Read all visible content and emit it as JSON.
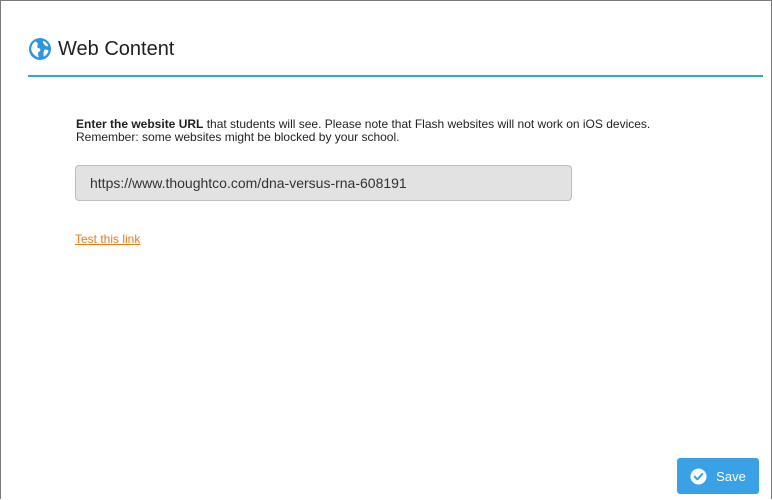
{
  "header": {
    "title": "Web Content",
    "icon": "globe-icon",
    "accent": "#35a0e6"
  },
  "description": {
    "bold": "Enter the website URL",
    "line1_rest": " that students will see. Please note that Flash websites will not work on iOS devices.",
    "line2": "Remember: some websites might be blocked by your school."
  },
  "url_input": {
    "value": "https://www.thoughtco.com/dna-versus-rna-608191"
  },
  "test_link": {
    "label": "Test this link",
    "color": "#f07a16"
  },
  "save_button": {
    "label": "Save",
    "icon": "check-circle-icon",
    "color": "#3aa1e6"
  }
}
